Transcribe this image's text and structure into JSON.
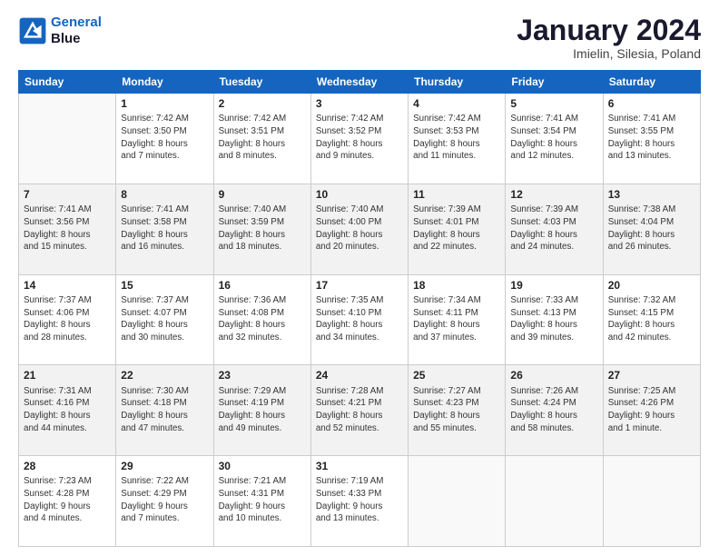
{
  "logo": {
    "line1": "General",
    "line2": "Blue"
  },
  "title": "January 2024",
  "subtitle": "Imielin, Silesia, Poland",
  "weekdays": [
    "Sunday",
    "Monday",
    "Tuesday",
    "Wednesday",
    "Thursday",
    "Friday",
    "Saturday"
  ],
  "weeks": [
    [
      {
        "day": "",
        "info": ""
      },
      {
        "day": "1",
        "info": "Sunrise: 7:42 AM\nSunset: 3:50 PM\nDaylight: 8 hours\nand 7 minutes."
      },
      {
        "day": "2",
        "info": "Sunrise: 7:42 AM\nSunset: 3:51 PM\nDaylight: 8 hours\nand 8 minutes."
      },
      {
        "day": "3",
        "info": "Sunrise: 7:42 AM\nSunset: 3:52 PM\nDaylight: 8 hours\nand 9 minutes."
      },
      {
        "day": "4",
        "info": "Sunrise: 7:42 AM\nSunset: 3:53 PM\nDaylight: 8 hours\nand 11 minutes."
      },
      {
        "day": "5",
        "info": "Sunrise: 7:41 AM\nSunset: 3:54 PM\nDaylight: 8 hours\nand 12 minutes."
      },
      {
        "day": "6",
        "info": "Sunrise: 7:41 AM\nSunset: 3:55 PM\nDaylight: 8 hours\nand 13 minutes."
      }
    ],
    [
      {
        "day": "7",
        "info": "Sunrise: 7:41 AM\nSunset: 3:56 PM\nDaylight: 8 hours\nand 15 minutes."
      },
      {
        "day": "8",
        "info": "Sunrise: 7:41 AM\nSunset: 3:58 PM\nDaylight: 8 hours\nand 16 minutes."
      },
      {
        "day": "9",
        "info": "Sunrise: 7:40 AM\nSunset: 3:59 PM\nDaylight: 8 hours\nand 18 minutes."
      },
      {
        "day": "10",
        "info": "Sunrise: 7:40 AM\nSunset: 4:00 PM\nDaylight: 8 hours\nand 20 minutes."
      },
      {
        "day": "11",
        "info": "Sunrise: 7:39 AM\nSunset: 4:01 PM\nDaylight: 8 hours\nand 22 minutes."
      },
      {
        "day": "12",
        "info": "Sunrise: 7:39 AM\nSunset: 4:03 PM\nDaylight: 8 hours\nand 24 minutes."
      },
      {
        "day": "13",
        "info": "Sunrise: 7:38 AM\nSunset: 4:04 PM\nDaylight: 8 hours\nand 26 minutes."
      }
    ],
    [
      {
        "day": "14",
        "info": "Sunrise: 7:37 AM\nSunset: 4:06 PM\nDaylight: 8 hours\nand 28 minutes."
      },
      {
        "day": "15",
        "info": "Sunrise: 7:37 AM\nSunset: 4:07 PM\nDaylight: 8 hours\nand 30 minutes."
      },
      {
        "day": "16",
        "info": "Sunrise: 7:36 AM\nSunset: 4:08 PM\nDaylight: 8 hours\nand 32 minutes."
      },
      {
        "day": "17",
        "info": "Sunrise: 7:35 AM\nSunset: 4:10 PM\nDaylight: 8 hours\nand 34 minutes."
      },
      {
        "day": "18",
        "info": "Sunrise: 7:34 AM\nSunset: 4:11 PM\nDaylight: 8 hours\nand 37 minutes."
      },
      {
        "day": "19",
        "info": "Sunrise: 7:33 AM\nSunset: 4:13 PM\nDaylight: 8 hours\nand 39 minutes."
      },
      {
        "day": "20",
        "info": "Sunrise: 7:32 AM\nSunset: 4:15 PM\nDaylight: 8 hours\nand 42 minutes."
      }
    ],
    [
      {
        "day": "21",
        "info": "Sunrise: 7:31 AM\nSunset: 4:16 PM\nDaylight: 8 hours\nand 44 minutes."
      },
      {
        "day": "22",
        "info": "Sunrise: 7:30 AM\nSunset: 4:18 PM\nDaylight: 8 hours\nand 47 minutes."
      },
      {
        "day": "23",
        "info": "Sunrise: 7:29 AM\nSunset: 4:19 PM\nDaylight: 8 hours\nand 49 minutes."
      },
      {
        "day": "24",
        "info": "Sunrise: 7:28 AM\nSunset: 4:21 PM\nDaylight: 8 hours\nand 52 minutes."
      },
      {
        "day": "25",
        "info": "Sunrise: 7:27 AM\nSunset: 4:23 PM\nDaylight: 8 hours\nand 55 minutes."
      },
      {
        "day": "26",
        "info": "Sunrise: 7:26 AM\nSunset: 4:24 PM\nDaylight: 8 hours\nand 58 minutes."
      },
      {
        "day": "27",
        "info": "Sunrise: 7:25 AM\nSunset: 4:26 PM\nDaylight: 9 hours\nand 1 minute."
      }
    ],
    [
      {
        "day": "28",
        "info": "Sunrise: 7:23 AM\nSunset: 4:28 PM\nDaylight: 9 hours\nand 4 minutes."
      },
      {
        "day": "29",
        "info": "Sunrise: 7:22 AM\nSunset: 4:29 PM\nDaylight: 9 hours\nand 7 minutes."
      },
      {
        "day": "30",
        "info": "Sunrise: 7:21 AM\nSunset: 4:31 PM\nDaylight: 9 hours\nand 10 minutes."
      },
      {
        "day": "31",
        "info": "Sunrise: 7:19 AM\nSunset: 4:33 PM\nDaylight: 9 hours\nand 13 minutes."
      },
      {
        "day": "",
        "info": ""
      },
      {
        "day": "",
        "info": ""
      },
      {
        "day": "",
        "info": ""
      }
    ]
  ]
}
